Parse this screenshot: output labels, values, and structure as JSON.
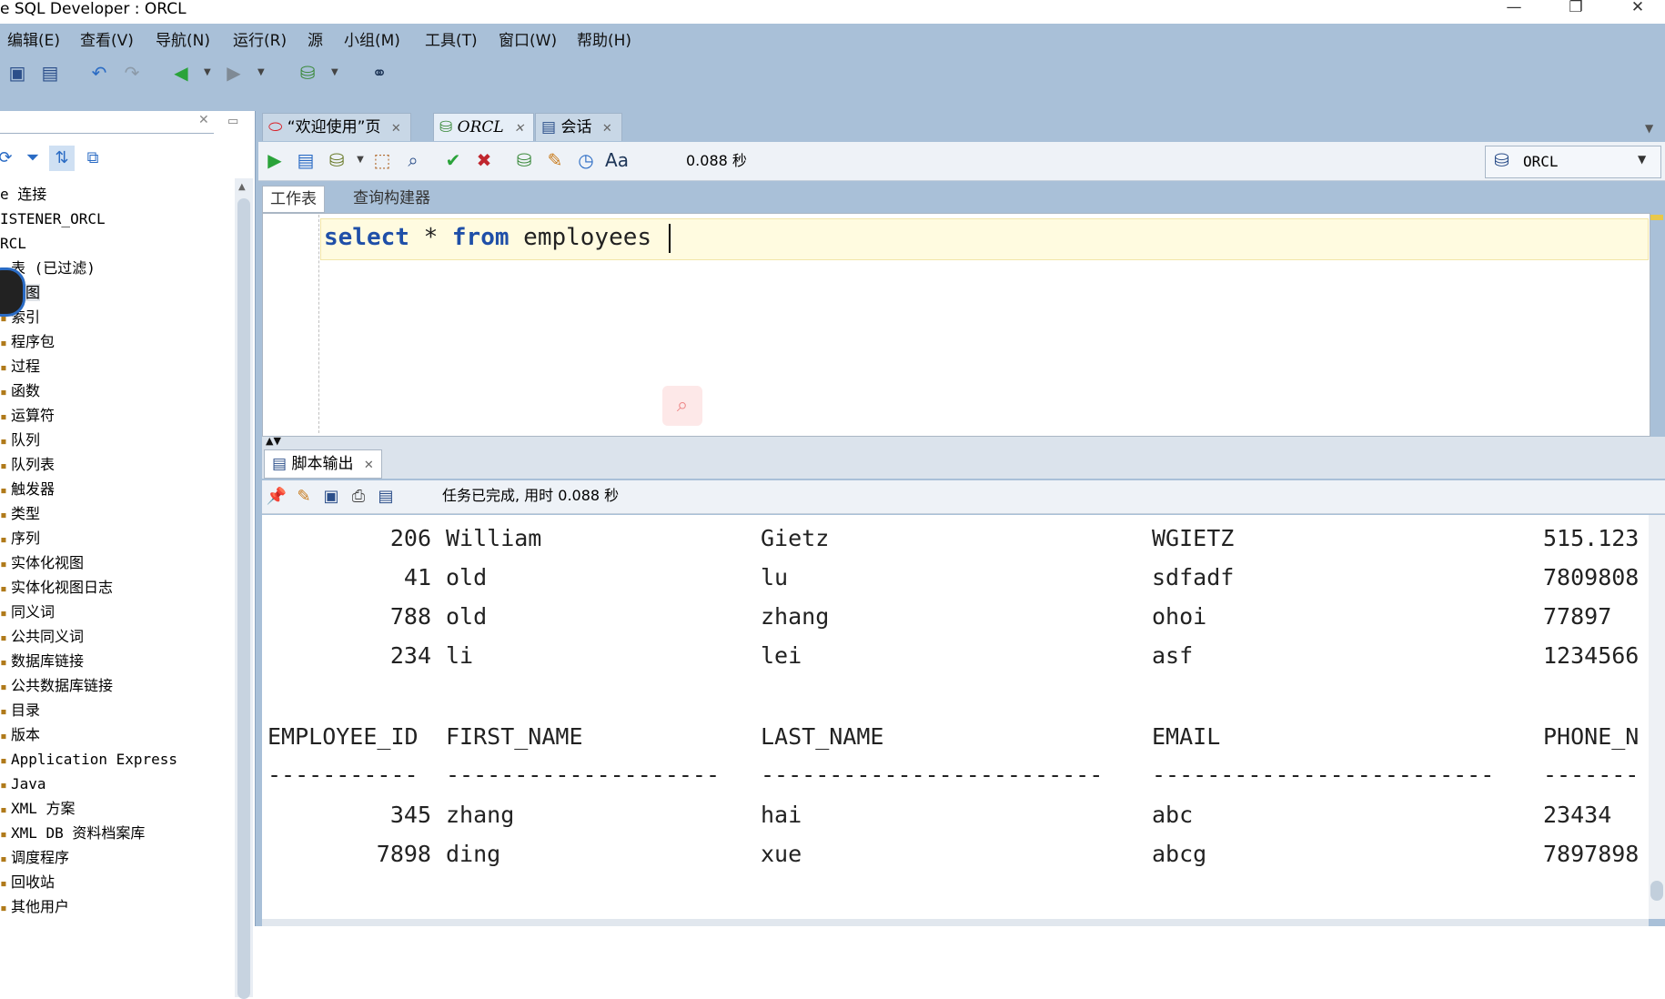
{
  "window": {
    "title": "e SQL Developer : ORCL",
    "minimize": "—",
    "restore": "❐",
    "close": "✕"
  },
  "menu": [
    "编辑(E)",
    "查看(V)",
    "导航(N)",
    "运行(R)",
    "源",
    "小组(M)",
    "工具(T)",
    "窗口(W)",
    "帮助(H)"
  ],
  "navigator": {
    "tree": [
      "e 连接",
      "ISTENER_ORCL",
      "RCL",
      "表 (已过滤)",
      "视图",
      "索引",
      "程序包",
      "过程",
      "函数",
      "运算符",
      "队列",
      "队列表",
      "触发器",
      "类型",
      "序列",
      "实体化视图",
      "实体化视图日志",
      "同义词",
      "公共同义词",
      "数据库链接",
      "公共数据库链接",
      "目录",
      "版本",
      "Application Express",
      "Java",
      "XML 方案",
      "XML DB 资料档案库",
      "调度程序",
      "回收站",
      "其他用户"
    ]
  },
  "editor_tabs": [
    {
      "label": "“欢迎使用”页",
      "active": false
    },
    {
      "label": "ORCL",
      "active": true
    },
    {
      "label": "会话",
      "active": false
    }
  ],
  "sql_toolbar": {
    "elapsed": "0.088 秒",
    "connection": "ORCL"
  },
  "sub_tabs": [
    "工作表",
    "查询构建器"
  ],
  "editor": {
    "keyword1": "select",
    "star": " * ",
    "keyword2": "from",
    "table": " employees"
  },
  "output": {
    "tab_label": "脚本输出",
    "status": "任务已完成, 用时 0.088 秒",
    "rows_before": [
      {
        "id": "206",
        "first": "William",
        "last": "Gietz",
        "email": "WGIETZ",
        "phone": "515.123"
      },
      {
        "id": "41",
        "first": "old",
        "last": "lu",
        "email": "sdfadf",
        "phone": "7809808"
      },
      {
        "id": "788",
        "first": "old",
        "last": "zhang",
        "email": "ohoi",
        "phone": "77897"
      },
      {
        "id": "234",
        "first": "li",
        "last": "lei",
        "email": "asf",
        "phone": "1234566"
      }
    ],
    "headers": {
      "id": "EMPLOYEE_ID",
      "first": "FIRST_NAME",
      "last": "LAST_NAME",
      "email": "EMAIL",
      "phone": "PHONE_N"
    },
    "dashes": {
      "id": "-----------",
      "first": "--------------------",
      "last": "-------------------------",
      "email": "-------------------------",
      "phone": "-------"
    },
    "rows_after": [
      {
        "id": "345",
        "first": "zhang",
        "last": "hai",
        "email": "abc",
        "phone": "23434"
      },
      {
        "id": "7898",
        "first": "ding",
        "last": "xue",
        "email": "abcg",
        "phone": "7897898"
      }
    ]
  }
}
